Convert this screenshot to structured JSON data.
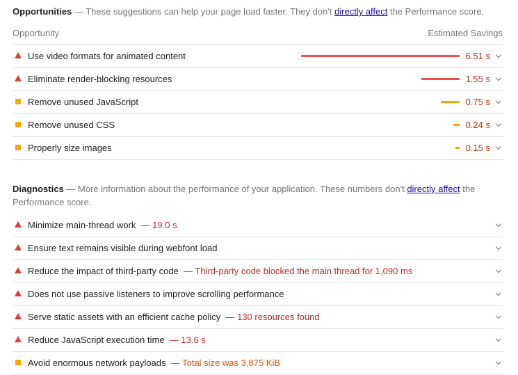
{
  "opportunities": {
    "title": "Opportunities",
    "desc_prefix": " — These suggestions can help your page load faster. They don't ",
    "link": "directly affect",
    "desc_suffix": " the Performance score.",
    "col_left": "Opportunity",
    "col_right": "Estimated Savings",
    "items": [
      {
        "label": "Use video formats for animated content",
        "saving": "6.51 s",
        "level": "fail",
        "bar_fraction": 1.0
      },
      {
        "label": "Eliminate render-blocking resources",
        "saving": "1.55 s",
        "level": "fail",
        "bar_fraction": 0.24
      },
      {
        "label": "Remove unused JavaScript",
        "saving": "0.75 s",
        "level": "average",
        "bar_fraction": 0.12
      },
      {
        "label": "Remove unused CSS",
        "saving": "0.24 s",
        "level": "average",
        "bar_fraction": 0.04
      },
      {
        "label": "Properly size images",
        "saving": "0.15 s",
        "level": "average",
        "bar_fraction": 0.025
      }
    ]
  },
  "diagnostics": {
    "title": "Diagnostics",
    "desc_prefix": " — More information about the performance of your application. These numbers don't ",
    "link": "directly affect",
    "desc_suffix": " the Performance score.",
    "items": [
      {
        "label": "Minimize main-thread work",
        "detail": "19.0 s",
        "level": "fail"
      },
      {
        "label": "Ensure text remains visible during webfont load",
        "detail": "",
        "level": "fail"
      },
      {
        "label": "Reduce the impact of third-party code",
        "detail": "Third-party code blocked the main thread for 1,090 ms",
        "level": "fail"
      },
      {
        "label": "Does not use passive listeners to improve scrolling performance",
        "detail": "",
        "level": "fail"
      },
      {
        "label": "Serve static assets with an efficient cache policy",
        "detail": "130 resources found",
        "level": "fail"
      },
      {
        "label": "Reduce JavaScript execution time",
        "detail": "13.6 s",
        "level": "fail"
      },
      {
        "label": "Avoid enormous network payloads",
        "detail": "Total size was 3,875 KiB",
        "level": "average"
      }
    ]
  },
  "colors": {
    "fail": "#eb5050",
    "average": "#ffa400",
    "link": "#1a0dab"
  },
  "icons": {
    "fail": "red-triangle-icon",
    "average": "orange-square-icon",
    "expand": "chevron-down-icon"
  }
}
